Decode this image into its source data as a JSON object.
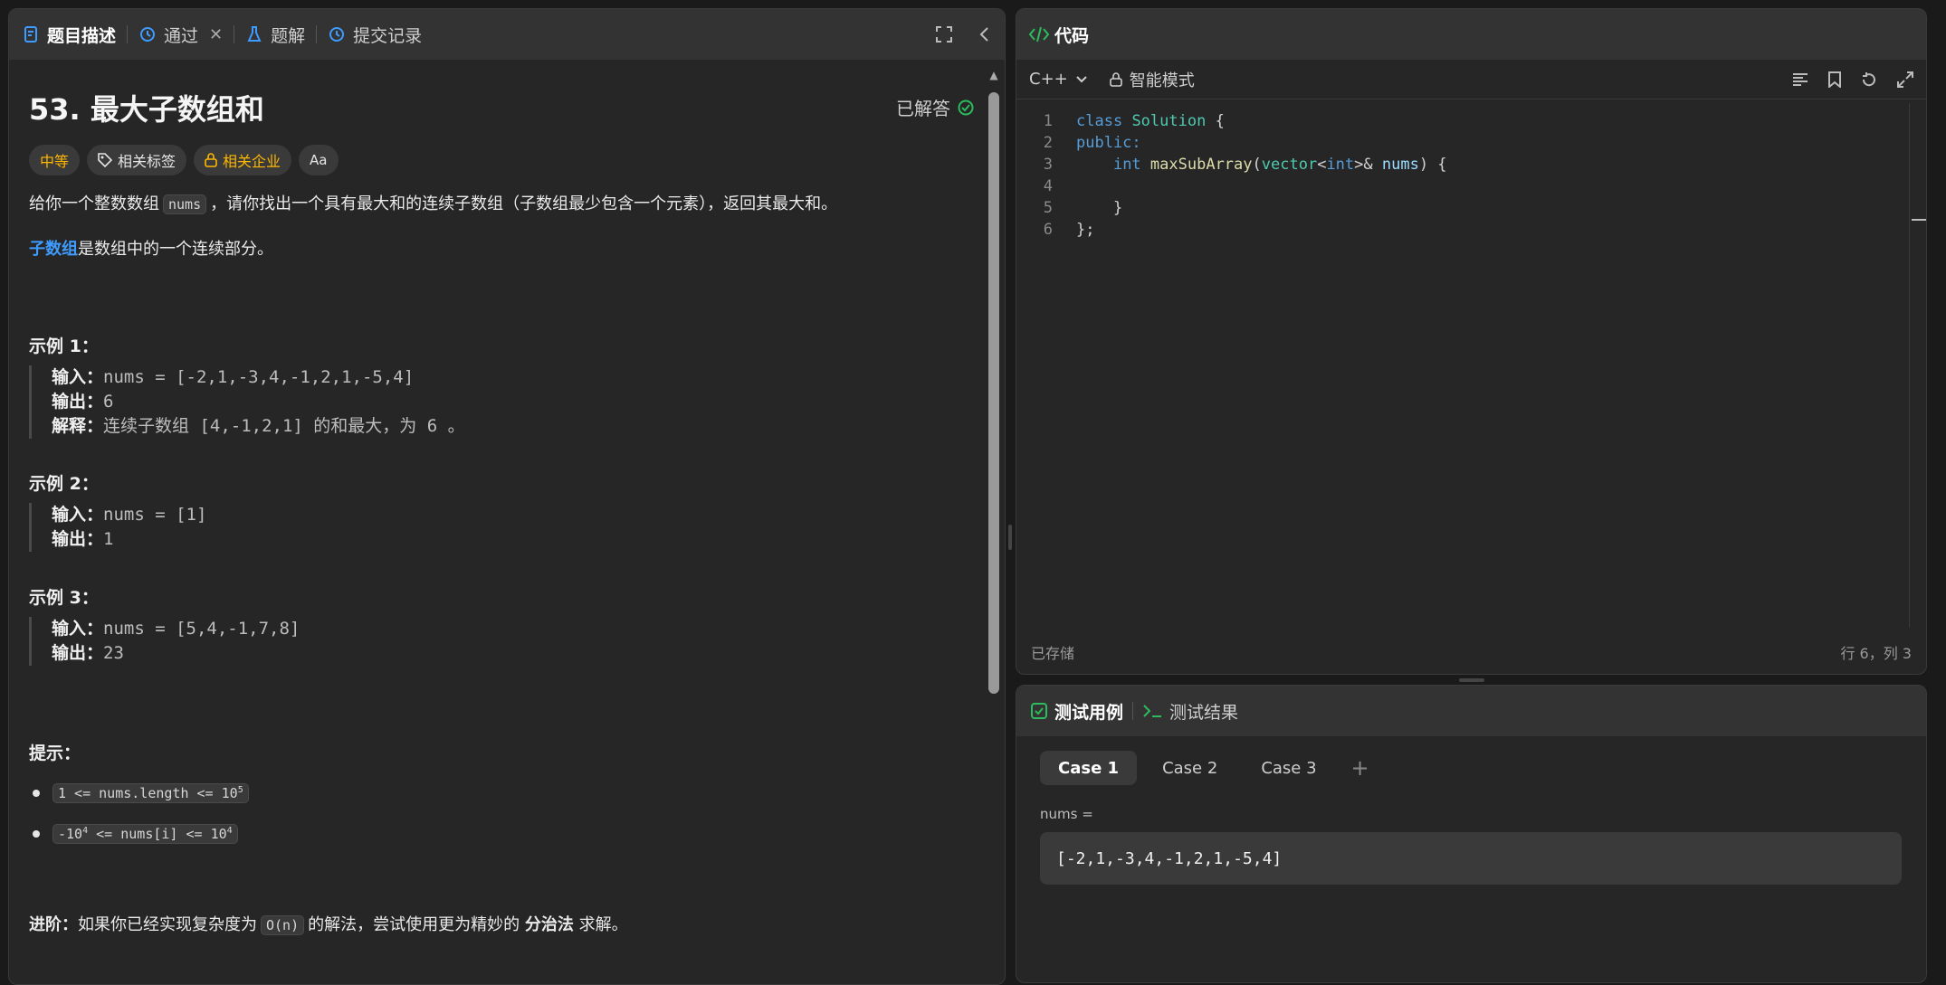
{
  "left_panel": {
    "tabs": [
      {
        "label": "题目描述",
        "icon": "document-icon",
        "active": true
      },
      {
        "label": "通过",
        "icon": "history-icon"
      },
      {
        "label": "题解",
        "icon": "flask-icon"
      },
      {
        "label": "提交记录",
        "icon": "history-icon"
      }
    ],
    "problem": {
      "title": "53. 最大子数组和",
      "status": "已解答",
      "tags": {
        "difficulty": "中等",
        "related_tags": "相关标签",
        "related_companies": "相关企业",
        "font": "Aa"
      },
      "statement_pre": "给你一个整数数组",
      "statement_code": "nums",
      "statement_post": "，请你找出一个具有最大和的连续子数组（子数组最少包含一个元素），返回其最大和。",
      "subarray_link": "子数组",
      "subarray_rest": "是数组中的一个连续部分。",
      "examples": [
        {
          "heading": "示例 1：",
          "input_label": "输入：",
          "input": "nums = [-2,1,-3,4,-1,2,1,-5,4]",
          "output_label": "输出：",
          "output": "6",
          "explain_label": "解释：",
          "explain": "连续子数组 [4,-1,2,1] 的和最大，为 6 。"
        },
        {
          "heading": "示例 2：",
          "input_label": "输入：",
          "input": "nums = [1]",
          "output_label": "输出：",
          "output": "1"
        },
        {
          "heading": "示例 3：",
          "input_label": "输入：",
          "input": "nums = [5,4,-1,7,8]",
          "output_label": "输出：",
          "output": "23"
        }
      ],
      "hints_heading": "提示：",
      "hint1_a": "1 <= nums.length <= 10",
      "hint1_sup": "5",
      "hint2_a": "-10",
      "hint2_sup1": "4",
      "hint2_b": " <= nums[i] <= 10",
      "hint2_sup2": "4",
      "advanced_label": "进阶：",
      "advanced_pre": "如果你已经实现复杂度为",
      "advanced_code": "O(n)",
      "advanced_mid": "的解法，尝试使用更为精妙的",
      "advanced_bold": "分治法",
      "advanced_post": "求解。"
    }
  },
  "code_panel": {
    "title": "代码",
    "language": "C++",
    "mode": "智能模式",
    "lines": [
      "1",
      "2",
      "3",
      "4",
      "5",
      "6"
    ],
    "code": {
      "l1_kw": "class",
      "l1_ty": "Solution",
      "l1_rest": " {",
      "l2": "public:",
      "l3_kw": "int",
      "l3_fn": "maxSubArray",
      "l3_p1": "(",
      "l3_ty": "vector",
      "l3_lt": "<",
      "l3_kw2": "int",
      "l3_gt": ">& ",
      "l3_va": "nums",
      "l3_end": ") {",
      "l5": "}",
      "l6": "};"
    },
    "saved": "已存储",
    "cursor": "行 6，列 3"
  },
  "test_panel": {
    "tab_cases": "测试用例",
    "tab_results": "测试结果",
    "cases": [
      "Case 1",
      "Case 2",
      "Case 3"
    ],
    "add": "+",
    "var_label": "nums =",
    "var_value": "[-2,1,-3,4,-1,2,1,-5,4]"
  },
  "colors": {
    "accent_green": "#2cbb5d",
    "link_blue": "#3e9bff",
    "medium": "#ffb800",
    "tab_icon_blue": "#3e9bff"
  }
}
